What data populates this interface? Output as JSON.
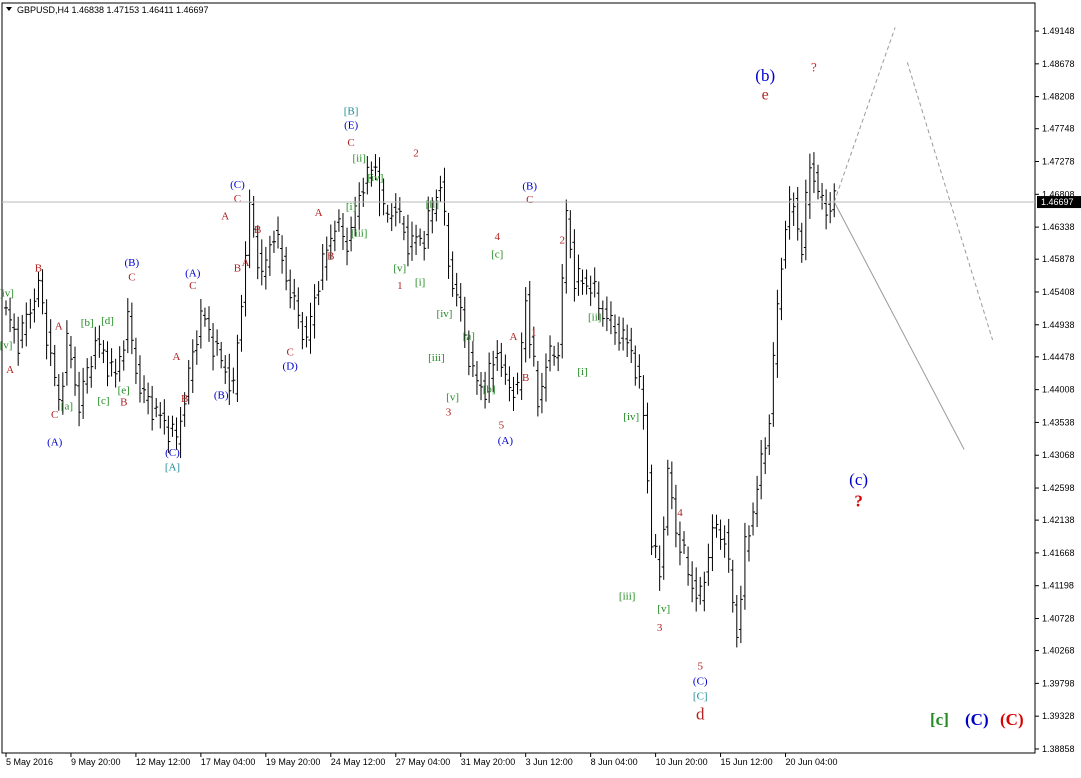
{
  "chart_data": {
    "type": "ohlc",
    "header": {
      "symbol": "GBPUSD,H4",
      "open": "1.46838",
      "high": "1.47153",
      "low": "1.46411",
      "close": "1.46697"
    },
    "current_price_label": "1.46697",
    "ylim": [
      1.388,
      1.4955
    ],
    "y_ticks": [
      "1.49148",
      "1.48678",
      "1.48208",
      "1.47748",
      "1.47278",
      "1.46808",
      "1.46338",
      "1.45878",
      "1.45408",
      "1.44938",
      "1.44478",
      "1.44008",
      "1.43538",
      "1.43068",
      "1.42598",
      "1.42138",
      "1.41668",
      "1.41198",
      "1.40728",
      "1.40268",
      "1.39798",
      "1.39328",
      "1.38858"
    ],
    "x_labels": [
      {
        "bar": 0,
        "label": "5 May 2016"
      },
      {
        "bar": 16,
        "label": "9 May 20:00"
      },
      {
        "bar": 32,
        "label": "12 May 12:00"
      },
      {
        "bar": 48,
        "label": "17 May 04:00"
      },
      {
        "bar": 64,
        "label": "19 May 20:00"
      },
      {
        "bar": 80,
        "label": "24 May 12:00"
      },
      {
        "bar": 96,
        "label": "27 May 04:00"
      },
      {
        "bar": 112,
        "label": "31 May 20:00"
      },
      {
        "bar": 128,
        "label": "3 Jun 12:00"
      },
      {
        "bar": 144,
        "label": "8 Jun 04:00"
      },
      {
        "bar": 160,
        "label": "10 Jun 20:00"
      },
      {
        "bar": 176,
        "label": "15 Jun 12:00"
      },
      {
        "bar": 192,
        "label": "20 Jun 04:00"
      }
    ],
    "pivots": [
      [
        0,
        1.451
      ],
      [
        3,
        1.447
      ],
      [
        8,
        1.455
      ],
      [
        13,
        1.438
      ],
      [
        15,
        1.447
      ],
      [
        18,
        1.438
      ],
      [
        22,
        1.447
      ],
      [
        27,
        1.442
      ],
      [
        30,
        1.45
      ],
      [
        33,
        1.44
      ],
      [
        38,
        1.436
      ],
      [
        42,
        1.433
      ],
      [
        45,
        1.442
      ],
      [
        48,
        1.451
      ],
      [
        53,
        1.444
      ],
      [
        56,
        1.44
      ],
      [
        60,
        1.466
      ],
      [
        63,
        1.456
      ],
      [
        66,
        1.463
      ],
      [
        70,
        1.454
      ],
      [
        74,
        1.447
      ],
      [
        77,
        1.456
      ],
      [
        81,
        1.464
      ],
      [
        84,
        1.461
      ],
      [
        88,
        1.47
      ],
      [
        91,
        1.472
      ],
      [
        93,
        1.465
      ],
      [
        96,
        1.466
      ],
      [
        99,
        1.461
      ],
      [
        103,
        1.462
      ],
      [
        107,
        1.47
      ],
      [
        109,
        1.458
      ],
      [
        112,
        1.451
      ],
      [
        115,
        1.442
      ],
      [
        118,
        1.44
      ],
      [
        121,
        1.446
      ],
      [
        123,
        1.441
      ],
      [
        126,
        1.44
      ],
      [
        128,
        1.453
      ],
      [
        131,
        1.438
      ],
      [
        133,
        1.444
      ],
      [
        136,
        1.446
      ],
      [
        138,
        1.465
      ],
      [
        140,
        1.456
      ],
      [
        144,
        1.455
      ],
      [
        147,
        1.451
      ],
      [
        151,
        1.448
      ],
      [
        154,
        1.446
      ],
      [
        157,
        1.437
      ],
      [
        159,
        1.418
      ],
      [
        161,
        1.414
      ],
      [
        163,
        1.428
      ],
      [
        165,
        1.42
      ],
      [
        169,
        1.412
      ],
      [
        171,
        1.41
      ],
      [
        174,
        1.42
      ],
      [
        177,
        1.419
      ],
      [
        180,
        1.405
      ],
      [
        182,
        1.417
      ],
      [
        185,
        1.426
      ],
      [
        188,
        1.436
      ],
      [
        190,
        1.452
      ],
      [
        192,
        1.464
      ],
      [
        194,
        1.467
      ],
      [
        196,
        1.46
      ],
      [
        198,
        1.473
      ],
      [
        200,
        1.468
      ],
      [
        202,
        1.466
      ],
      [
        204,
        1.467
      ]
    ],
    "projections": [
      {
        "from": [
          204,
          1.467
        ],
        "to": [
          219,
          1.492
        ],
        "style": "dashed"
      },
      {
        "from": [
          222,
          1.487
        ],
        "to": [
          243,
          1.4472
        ],
        "style": "dashed"
      },
      {
        "from": [
          204,
          1.467
        ],
        "to": [
          236,
          1.4315
        ],
        "style": "solid"
      }
    ],
    "annotations": [
      {
        "t": "B",
        "b": 8,
        "y": 1.457,
        "c": "#b22222"
      },
      {
        "t": "[iv]",
        "b": 0,
        "y": 1.4534,
        "c": "#228b22",
        "f": "b"
      },
      {
        "t": "[v]",
        "b": 0,
        "y": 1.446,
        "c": "#228b22",
        "f": "b"
      },
      {
        "t": "A",
        "b": 1,
        "y": 1.4425,
        "c": "#b22222"
      },
      {
        "t": "A",
        "b": 13,
        "y": 1.4487,
        "c": "#b22222"
      },
      {
        "t": "C",
        "b": 12,
        "y": 1.436,
        "c": "#b22222"
      },
      {
        "t": "[a]",
        "b": 15,
        "y": 1.4372,
        "c": "#228b22",
        "f": "b"
      },
      {
        "t": "(A)",
        "b": 12,
        "y": 1.4321,
        "c": "#0000cd"
      },
      {
        "t": "[b]",
        "b": 20,
        "y": 1.4492,
        "c": "#228b22",
        "f": "b"
      },
      {
        "t": "[c]",
        "b": 24,
        "y": 1.438,
        "c": "#228b22",
        "f": "b"
      },
      {
        "t": "[d]",
        "b": 25,
        "y": 1.4495,
        "c": "#228b22",
        "f": "b"
      },
      {
        "t": "[e]",
        "b": 29,
        "y": 1.4395,
        "c": "#228b22",
        "f": "b"
      },
      {
        "t": "B",
        "b": 29,
        "y": 1.4378,
        "c": "#b22222"
      },
      {
        "t": "(B)",
        "b": 31,
        "y": 1.4578,
        "c": "#0000cd"
      },
      {
        "t": "C",
        "b": 31,
        "y": 1.4557,
        "c": "#b22222"
      },
      {
        "t": "A",
        "b": 42,
        "y": 1.4443,
        "c": "#b22222"
      },
      {
        "t": "B",
        "b": 44,
        "y": 1.4383,
        "c": "#b22222"
      },
      {
        "t": "(C)",
        "b": 41,
        "y": 1.4306,
        "c": "#0000cd"
      },
      {
        "t": "[A]",
        "b": 41,
        "y": 1.4285,
        "c": "#1e8c96",
        "f": "b"
      },
      {
        "t": "(A)",
        "b": 46,
        "y": 1.4563,
        "c": "#0000cd"
      },
      {
        "t": "C",
        "b": 46,
        "y": 1.4545,
        "c": "#b22222"
      },
      {
        "t": "(B)",
        "b": 53,
        "y": 1.4388,
        "c": "#0000cd"
      },
      {
        "t": "(C)",
        "b": 57,
        "y": 1.469,
        "c": "#0000cd"
      },
      {
        "t": "C",
        "b": 57,
        "y": 1.467,
        "c": "#b22222"
      },
      {
        "t": "A",
        "b": 54,
        "y": 1.4645,
        "c": "#b22222"
      },
      {
        "t": "B",
        "b": 62,
        "y": 1.4625,
        "c": "#b22222"
      },
      {
        "t": "B",
        "b": 57,
        "y": 1.457,
        "c": "#b22222"
      },
      {
        "t": "A",
        "b": 59,
        "y": 1.4578,
        "c": "#b22222"
      },
      {
        "t": "C",
        "b": 70,
        "y": 1.445,
        "c": "#b22222"
      },
      {
        "t": "(D)",
        "b": 70,
        "y": 1.443,
        "c": "#0000cd"
      },
      {
        "t": "A",
        "b": 77,
        "y": 1.465,
        "c": "#b22222"
      },
      {
        "t": "B",
        "b": 80,
        "y": 1.4587,
        "c": "#b22222"
      },
      {
        "t": "[B]",
        "b": 85,
        "y": 1.4795,
        "c": "#1e8c96",
        "f": "b"
      },
      {
        "t": "(E)",
        "b": 85,
        "y": 1.4775,
        "c": "#0000cd"
      },
      {
        "t": "C",
        "b": 85,
        "y": 1.475,
        "c": "#b22222"
      },
      {
        "t": "[ii]",
        "b": 87,
        "y": 1.4728,
        "c": "#228b22",
        "f": "b"
      },
      {
        "t": "[iv]",
        "b": 91,
        "y": 1.47,
        "c": "#228b22",
        "f": "b"
      },
      {
        "t": "[i]",
        "b": 85,
        "y": 1.4658,
        "c": "#228b22",
        "f": "b"
      },
      {
        "t": "[iii]",
        "b": 87,
        "y": 1.462,
        "c": "#228b22",
        "f": "b"
      },
      {
        "t": "2",
        "b": 101,
        "y": 1.4735,
        "c": "#b22222"
      },
      {
        "t": "[ii]",
        "b": 105,
        "y": 1.4662,
        "c": "#228b22",
        "f": "b"
      },
      {
        "t": "[v]",
        "b": 97,
        "y": 1.457,
        "c": "#228b22",
        "f": "b"
      },
      {
        "t": "1",
        "b": 97,
        "y": 1.4545,
        "c": "#b22222"
      },
      {
        "t": "[i]",
        "b": 102,
        "y": 1.455,
        "c": "#228b22",
        "f": "b"
      },
      {
        "t": "[iv]",
        "b": 108,
        "y": 1.4505,
        "c": "#228b22",
        "f": "b"
      },
      {
        "t": "[a]",
        "b": 114,
        "y": 1.4473,
        "c": "#228b22",
        "f": "b"
      },
      {
        "t": "[iii]",
        "b": 106,
        "y": 1.4442,
        "c": "#228b22",
        "f": "b"
      },
      {
        "t": "[v]",
        "b": 110,
        "y": 1.4385,
        "c": "#228b22",
        "f": "b"
      },
      {
        "t": "3",
        "b": 109,
        "y": 1.4364,
        "c": "#b22222"
      },
      {
        "t": "[b]",
        "b": 119,
        "y": 1.4397,
        "c": "#228b22",
        "f": "b"
      },
      {
        "t": "4",
        "b": 121,
        "y": 1.4615,
        "c": "#b22222"
      },
      {
        "t": "[c]",
        "b": 121,
        "y": 1.459,
        "c": "#228b22",
        "f": "b"
      },
      {
        "t": "5",
        "b": 122,
        "y": 1.4345,
        "c": "#b22222"
      },
      {
        "t": "(A)",
        "b": 123,
        "y": 1.4323,
        "c": "#0000cd"
      },
      {
        "t": "A",
        "b": 125,
        "y": 1.4472,
        "c": "#b22222"
      },
      {
        "t": "1",
        "b": 130,
        "y": 1.4478,
        "c": "#b22222"
      },
      {
        "t": "B",
        "b": 128,
        "y": 1.4413,
        "c": "#b22222"
      },
      {
        "t": "(B)",
        "b": 129,
        "y": 1.4688,
        "c": "#0000cd"
      },
      {
        "t": "C",
        "b": 129,
        "y": 1.4668,
        "c": "#b22222"
      },
      {
        "t": "2",
        "b": 137,
        "y": 1.461,
        "c": "#b22222"
      },
      {
        "t": "[ii]",
        "b": 145,
        "y": 1.45,
        "c": "#228b22",
        "f": "b"
      },
      {
        "t": "[i]",
        "b": 142,
        "y": 1.4422,
        "c": "#228b22",
        "f": "b"
      },
      {
        "t": "[iv]",
        "b": 154,
        "y": 1.4357,
        "c": "#228b22",
        "f": "b"
      },
      {
        "t": "[iii]",
        "b": 153,
        "y": 1.41,
        "c": "#228b22",
        "f": "b"
      },
      {
        "t": "[v]",
        "b": 162,
        "y": 1.4082,
        "c": "#228b22",
        "f": "b"
      },
      {
        "t": "3",
        "b": 161,
        "y": 1.4055,
        "c": "#b22222"
      },
      {
        "t": "4",
        "b": 166,
        "y": 1.422,
        "c": "#b22222"
      },
      {
        "t": "5",
        "b": 171,
        "y": 1.4,
        "c": "#b22222"
      },
      {
        "t": "(C)",
        "b": 171,
        "y": 1.3978,
        "c": "#0000cd"
      },
      {
        "t": "[C]",
        "b": 171,
        "y": 1.3957,
        "c": "#1e8c96",
        "f": "b"
      },
      {
        "t": "d",
        "b": 171,
        "y": 1.3928,
        "c": "#b22222",
        "s": 17
      },
      {
        "t": "(b)",
        "b": 187,
        "y": 1.4843,
        "c": "#0000cd",
        "s": 17
      },
      {
        "t": "e",
        "b": 187,
        "y": 1.4817,
        "c": "#b22222",
        "s": 16
      },
      {
        "t": "?",
        "b": 199,
        "y": 1.4857,
        "c": "#dd2222",
        "s": 13
      },
      {
        "t": "(c)",
        "b": 210,
        "y": 1.4264,
        "c": "#0000cd",
        "s": 17
      },
      {
        "t": "?",
        "b": 210,
        "y": 1.4233,
        "c": "#dd0000",
        "s": 17,
        "fw": "bold"
      }
    ],
    "legend": [
      {
        "t": "[c]",
        "c": "#228b22"
      },
      {
        "t": "(C)",
        "c": "#0000cd"
      },
      {
        "t": "(C)",
        "c": "#dd0000"
      }
    ]
  }
}
